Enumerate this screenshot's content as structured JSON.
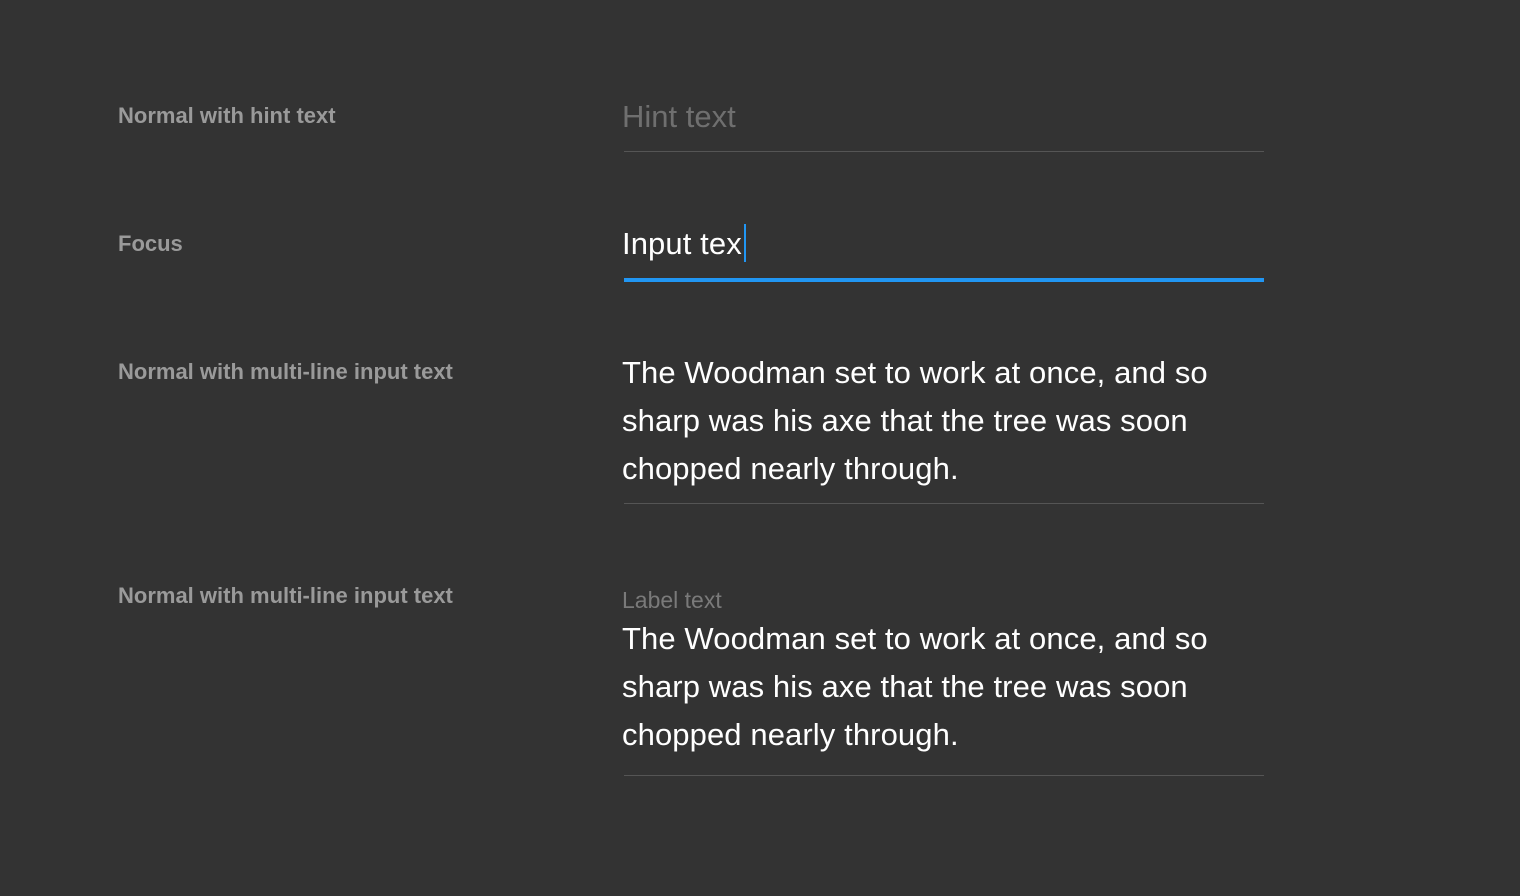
{
  "rows": [
    {
      "label": "Normal with hint text",
      "hint": "Hint text"
    },
    {
      "label": "Focus",
      "value": "Input tex"
    },
    {
      "label": "Normal with multi-line input text",
      "lines": [
        "The Woodman set to work at once, and so",
        "sharp was his axe that the tree was soon",
        "chopped nearly through."
      ]
    },
    {
      "label": "Normal with multi-line input text",
      "floating_label": "Label text",
      "lines": [
        "The Woodman set to work at once, and so",
        "sharp was his axe that the tree was soon",
        "chopped nearly through."
      ]
    }
  ],
  "colors": {
    "background": "#333333",
    "row_label": "#9a9a9a",
    "hint": "#6f6f6f",
    "input_text": "#ffffff",
    "underline": "#555555",
    "focus_accent": "#2196f3"
  }
}
